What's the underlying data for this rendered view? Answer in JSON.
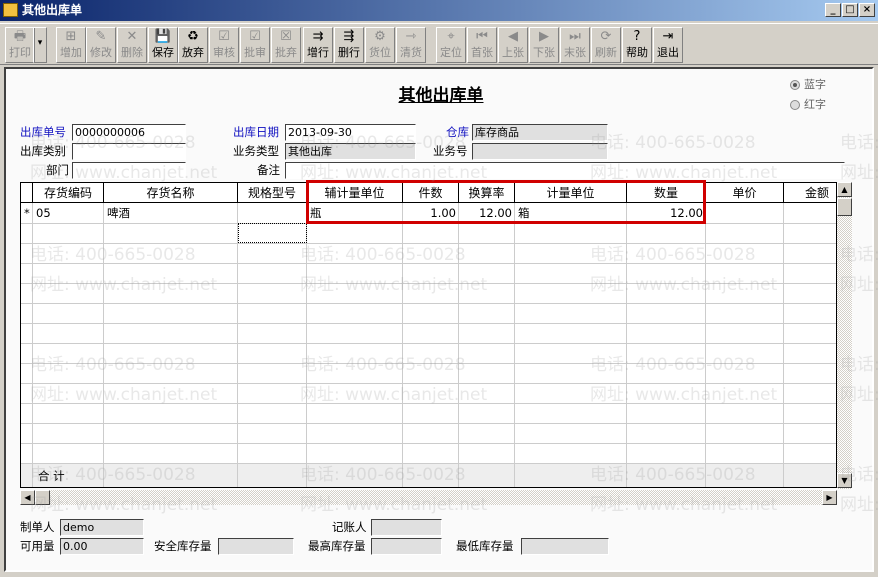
{
  "window": {
    "title": "其他出库单",
    "min": "_",
    "max": "□",
    "close": "×"
  },
  "toolbar": [
    {
      "label": "打印",
      "icon": "🖶",
      "on": false
    },
    {
      "label": "▾",
      "icon": "",
      "on": true
    },
    {
      "label": "增加",
      "icon": "⊞",
      "on": false
    },
    {
      "label": "修改",
      "icon": "✎",
      "on": false
    },
    {
      "label": "删除",
      "icon": "✕",
      "on": false
    },
    {
      "label": "保存",
      "icon": "💾",
      "on": true
    },
    {
      "label": "放弃",
      "icon": "♻",
      "on": true
    },
    {
      "label": "审核",
      "icon": "☑",
      "on": false
    },
    {
      "label": "批审",
      "icon": "☑",
      "on": false
    },
    {
      "label": "批弃",
      "icon": "☒",
      "on": false
    },
    {
      "label": "增行",
      "icon": "⇉",
      "on": true
    },
    {
      "label": "删行",
      "icon": "⇶",
      "on": true
    },
    {
      "label": "货位",
      "icon": "⚙",
      "on": false
    },
    {
      "label": "清货",
      "icon": "⇾",
      "on": false
    },
    {
      "label": "定位",
      "icon": "⌖",
      "on": false
    },
    {
      "label": "首张",
      "icon": "⏮",
      "on": false
    },
    {
      "label": "上张",
      "icon": "◀",
      "on": false
    },
    {
      "label": "下张",
      "icon": "▶",
      "on": false
    },
    {
      "label": "末张",
      "icon": "⏭",
      "on": false
    },
    {
      "label": "刷新",
      "icon": "⟳",
      "on": false
    },
    {
      "label": "帮助",
      "icon": "?",
      "on": true
    },
    {
      "label": "退出",
      "icon": "⇥",
      "on": true
    }
  ],
  "doc_title": "其他出库单",
  "radios": {
    "blue": "蓝字",
    "red": "红字",
    "selected": "blue"
  },
  "header": {
    "out_no_label": "出库单号",
    "out_no": "0000000006",
    "out_date_label": "出库日期",
    "out_date": "2013-09-30",
    "warehouse_label": "仓库",
    "warehouse": "库存商品",
    "out_type_label": "出库类别",
    "out_type": "",
    "biz_type_label": "业务类型",
    "biz_type": "其他出库",
    "biz_no_label": "业务号",
    "biz_no": "",
    "dept_label": "部门",
    "dept": "",
    "remark_label": "备注",
    "remark": ""
  },
  "table": {
    "columns": [
      "",
      "存货编码",
      "存货名称",
      "规格型号",
      "辅计量单位",
      "件数",
      "换算率",
      "计量单位",
      "数量",
      "单价",
      "金额"
    ],
    "rows": [
      [
        "*",
        "05",
        "啤酒",
        "",
        "瓶",
        "1.00",
        "12.00",
        "箱",
        "12.00",
        "",
        ""
      ]
    ],
    "sum_label": "合 计"
  },
  "footer": {
    "maker_label": "制单人",
    "maker": "demo",
    "booker_label": "记账人",
    "booker": "",
    "avail_label": "可用量",
    "avail": "0.00",
    "safe_label": "安全库存量",
    "safe": "",
    "max_label": "最高库存量",
    "max": "",
    "min_label": "最低库存量",
    "min": ""
  },
  "watermark": {
    "phone": "电话: 400-665-0028",
    "site": "网址: www.chanjet.net"
  }
}
